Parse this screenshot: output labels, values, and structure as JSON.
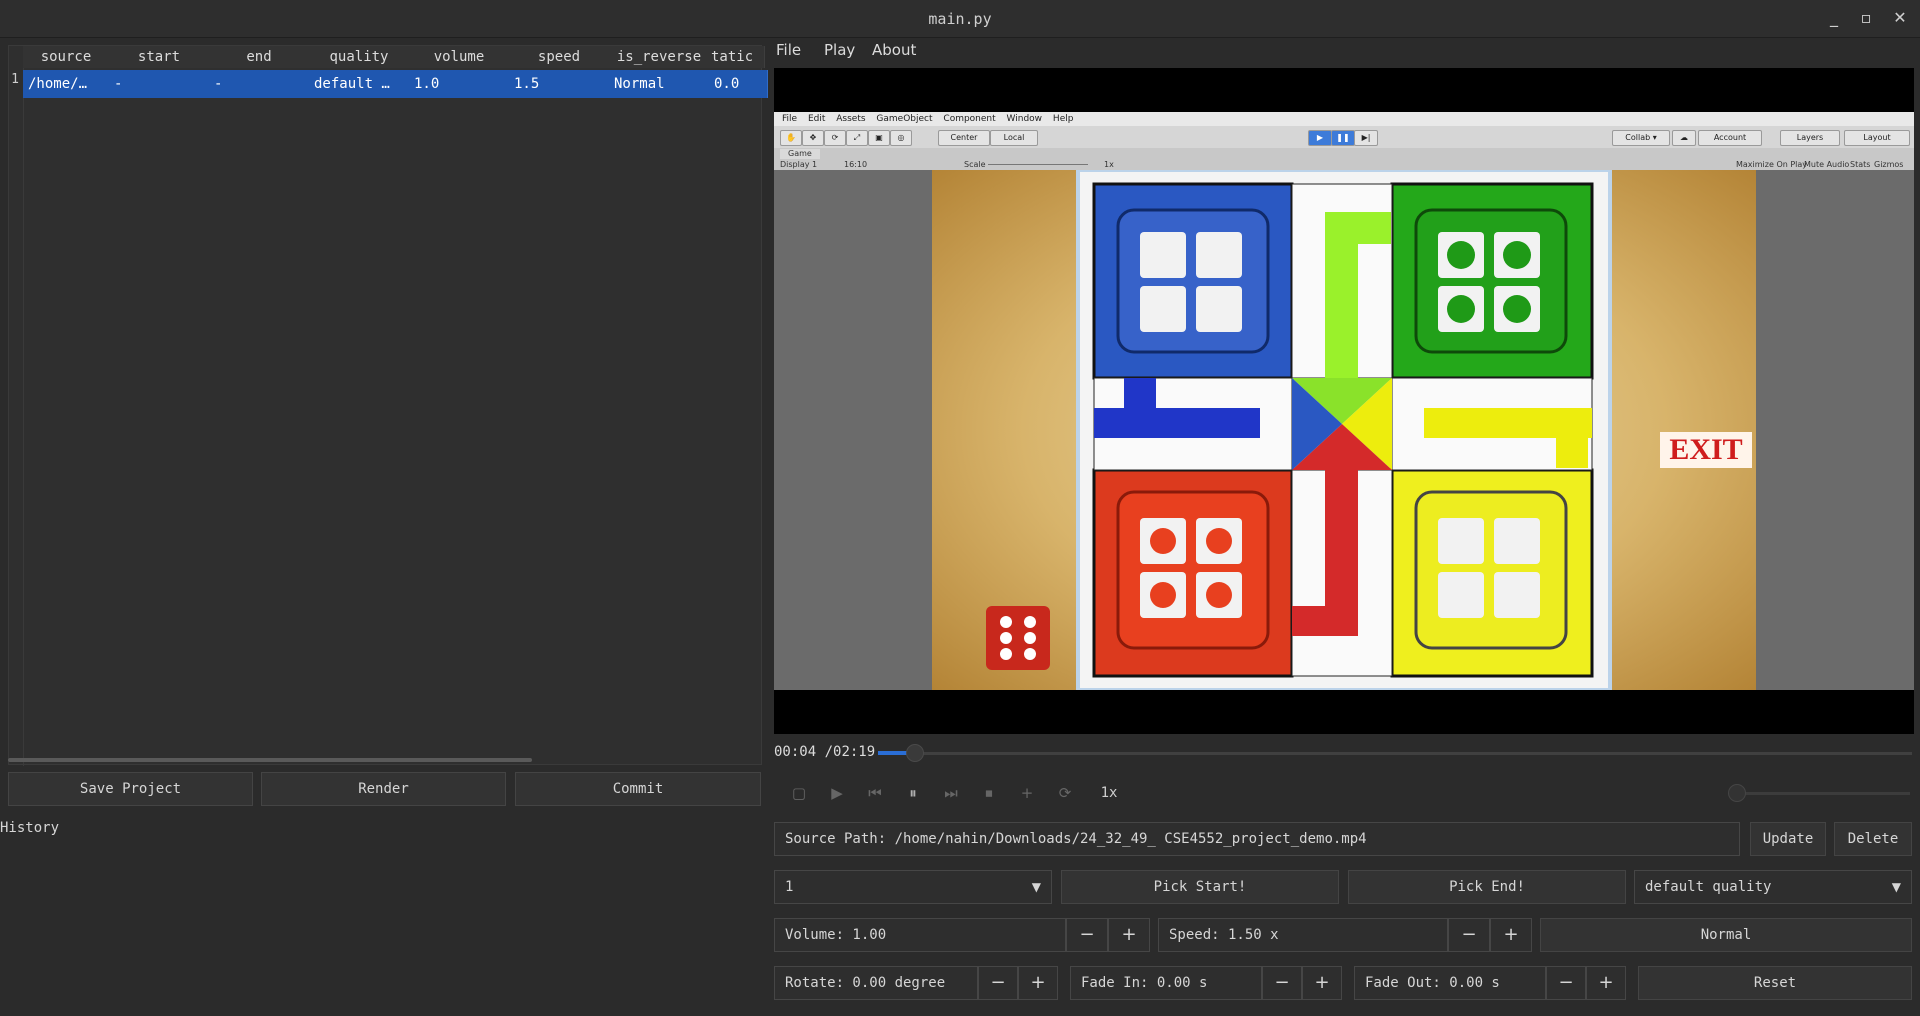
{
  "window": {
    "title": "main.py",
    "minimize": "_",
    "maximize": "▫",
    "close": "✕"
  },
  "table": {
    "headers": [
      "source",
      "start",
      "end",
      "quality",
      "volume",
      "speed",
      "is_reverse",
      "tatic"
    ],
    "row_number": "1",
    "row": [
      "/home/…",
      "-",
      "-",
      "default …",
      "1.0",
      "1.5",
      "Normal",
      "0.0"
    ]
  },
  "left_buttons": {
    "save": "Save Project",
    "render": "Render",
    "commit": "Commit"
  },
  "history": {
    "label": "History"
  },
  "menu": {
    "file": "File",
    "play": "Play",
    "about": "About"
  },
  "video": {
    "unity_menu": [
      "File",
      "Edit",
      "Assets",
      "GameObject",
      "Component",
      "Window",
      "Help"
    ],
    "unity_toolbar": {
      "center": "Center",
      "local": "Local",
      "collab": "Collab ▾",
      "account": "Account",
      "layers": "Layers",
      "layout": "Layout"
    },
    "game_tab": {
      "tab": "Game",
      "display": "Display 1",
      "aspect": "16:10",
      "scale_label": "Scale",
      "scale_value": "1x",
      "maximize": "Maximize On Play",
      "mute": "Mute Audio",
      "stats": "Stats",
      "gizmos": "Gizmos"
    },
    "exit_sign": "EXIT"
  },
  "player": {
    "current_time": "00:04",
    "total_time": "/02:19",
    "progress": 0.03,
    "speed_label": "1x"
  },
  "source": {
    "path_value": "Source Path: /home/nahin/Downloads/24_32_49_ CSE4552_project_demo.mp4",
    "update": "Update",
    "delete": "Delete"
  },
  "clip": {
    "index_value": "1",
    "pick_start": "Pick Start!",
    "pick_end": "Pick End!",
    "quality_value": "default quality"
  },
  "adjust": {
    "volume": "Volume: 1.00",
    "speed": "Speed: 1.50 x",
    "direction": "Normal",
    "rotate": "Rotate: 0.00 degree",
    "fade_in": "Fade In: 0.00 s",
    "fade_out": "Fade Out: 0.00 s",
    "reset": "Reset",
    "minus": "−",
    "plus": "+"
  },
  "colors": {
    "accent": "#1f57b0",
    "background": "#2b2b2b"
  }
}
